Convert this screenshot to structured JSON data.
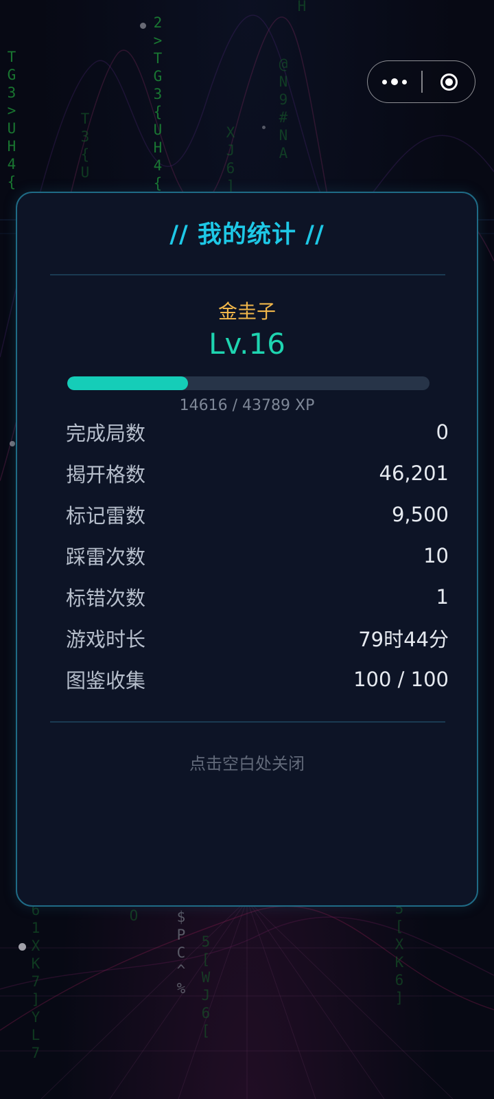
{
  "background": {
    "matrix_columns": [
      {
        "id": "c1",
        "chars": "T\nG\n3\n>\nU\nH\n4\n{",
        "tone": "green"
      },
      {
        "id": "c2",
        "chars": "T\n3\n{\nU",
        "tone": "dim"
      },
      {
        "id": "c3",
        "chars": "2\n>\nT\nG\n3\n{\nU\nH\n4\n{",
        "tone": "green"
      },
      {
        "id": "c4",
        "chars": "X\nJ\n6\n]",
        "tone": "dim"
      },
      {
        "id": "c5",
        "chars": "@\nN\n9\n#\nN\nA",
        "tone": "dim"
      },
      {
        "id": "c6",
        "chars": "H",
        "tone": "dim"
      },
      {
        "id": "c7",
        "chars": "6\n1\nX\nK\n7\n]\nY\nL\n7",
        "tone": "dim"
      },
      {
        "id": "c8",
        "chars": "O",
        "tone": "dim"
      },
      {
        "id": "c9",
        "chars": "$\nP\nC\n^\n%",
        "tone": "gray"
      },
      {
        "id": "c10",
        "chars": "5\n[\nW\nJ\n6\n[",
        "tone": "dim"
      },
      {
        "id": "c11",
        "chars": "5\n[\nX\nK\n6\n]",
        "tone": "dim"
      }
    ]
  },
  "capsule": {
    "more_icon": "more-dots-icon",
    "close_icon": "target-close-icon"
  },
  "modal": {
    "title": "// 我的统计 //",
    "player_name": "金圭子",
    "level": "Lv.16",
    "xp": {
      "current": 14616,
      "max": 43789,
      "progress_fraction": 0.334,
      "text": "14616 / 43789 XP"
    },
    "stats": [
      {
        "key": "games-completed",
        "label": "完成局数",
        "value": "0"
      },
      {
        "key": "cells-revealed",
        "label": "揭开格数",
        "value": "46,201"
      },
      {
        "key": "mines-flagged",
        "label": "标记雷数",
        "value": "9,500"
      },
      {
        "key": "mines-hit",
        "label": "踩雷次数",
        "value": "10"
      },
      {
        "key": "wrong-flags",
        "label": "标错次数",
        "value": "1"
      },
      {
        "key": "play-time",
        "label": "游戏时长",
        "value": "79时44分"
      },
      {
        "key": "collection",
        "label": "图鉴收集",
        "value": "100 / 100"
      }
    ],
    "close_hint": "点击空白处关闭"
  },
  "colors": {
    "accent_cyan": "#1ec8e6",
    "level_green": "#1ed4b0",
    "name_gold": "#f0b64a",
    "modal_border": "#1f6b86",
    "modal_bg": "#0d1426",
    "xp_fill": "#15cdb8"
  }
}
